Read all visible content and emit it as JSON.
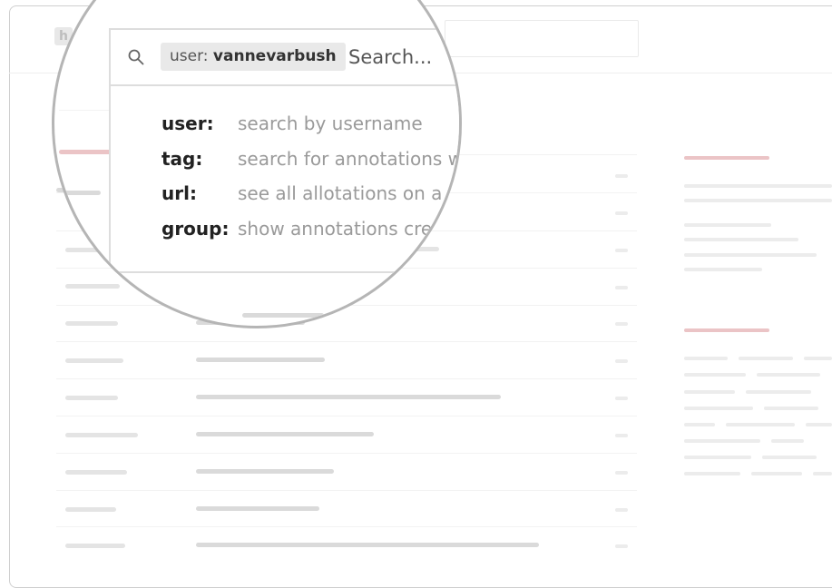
{
  "app": {
    "logo_letter": "h"
  },
  "search": {
    "chip_prefix": "user:",
    "chip_value": "vannevarbush",
    "placeholder": "Search..."
  },
  "suggestions": [
    {
      "key": "user:",
      "description": "search by username"
    },
    {
      "key": "tag:",
      "description": "search for annotations w"
    },
    {
      "key": "url:",
      "description": "see all allotations on a"
    },
    {
      "key": "group:",
      "description": "show annotations cre"
    }
  ],
  "colors": {
    "accent": "#e4a7aa",
    "border": "#b5b5b5",
    "muted_text": "#9a9a9a"
  },
  "icons": {
    "search": "magnifier-icon"
  }
}
